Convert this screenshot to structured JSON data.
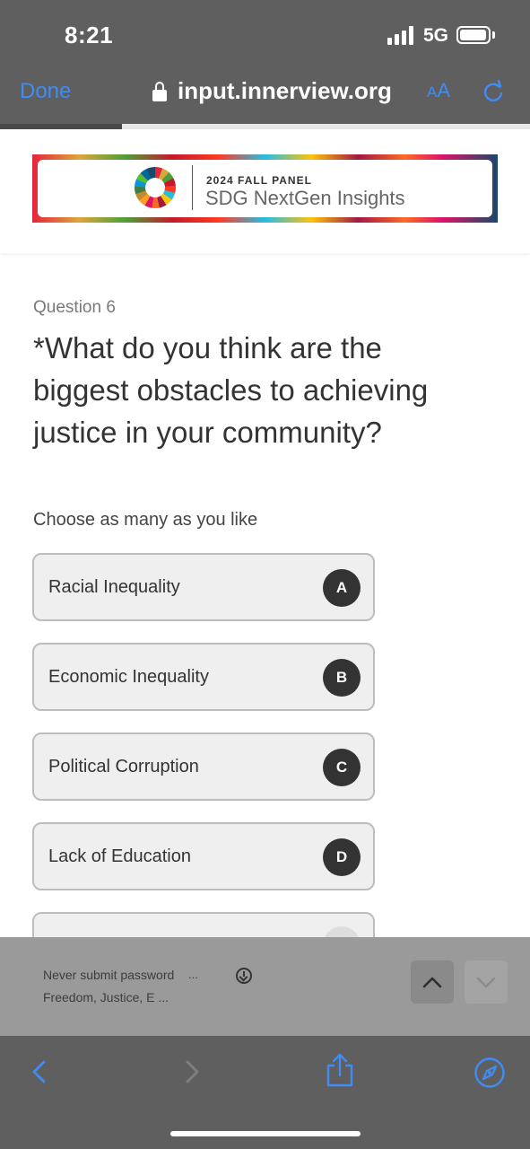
{
  "status_bar": {
    "time": "8:21",
    "network": "5G",
    "battery_level": 0.95
  },
  "browser": {
    "done_label": "Done",
    "url": "input.innerview.org",
    "text_size_label_big": "A",
    "text_size_label_small": "A",
    "page_progress": 0.23,
    "accent_color": "#3f8cf5"
  },
  "banner": {
    "kicker": "2024 FALL PANEL",
    "title": "SDG NextGen Insights"
  },
  "question": {
    "number": "Question 6",
    "text": "*What do you think are the biggest obstacles to achieving justice in your community?",
    "hint": "Choose as many as you like"
  },
  "options": [
    {
      "label": "Racial Inequality",
      "key": "A"
    },
    {
      "label": "Economic Inequality",
      "key": "B"
    },
    {
      "label": "Political Corruption",
      "key": "C"
    },
    {
      "label": "Lack of Education",
      "key": "D"
    }
  ],
  "autofill": {
    "suggestion_1": "Never submit password",
    "suggestion_2": "Freedom, Justice, E ...",
    "more": "..."
  },
  "icons": {
    "lock": "lock-icon",
    "reload": "reload-icon",
    "back": "chevron-left-icon",
    "forward": "chevron-right-icon",
    "share": "share-icon",
    "safari": "compass-icon",
    "prev_field": "chevron-up-icon",
    "next_field": "chevron-down-icon"
  }
}
